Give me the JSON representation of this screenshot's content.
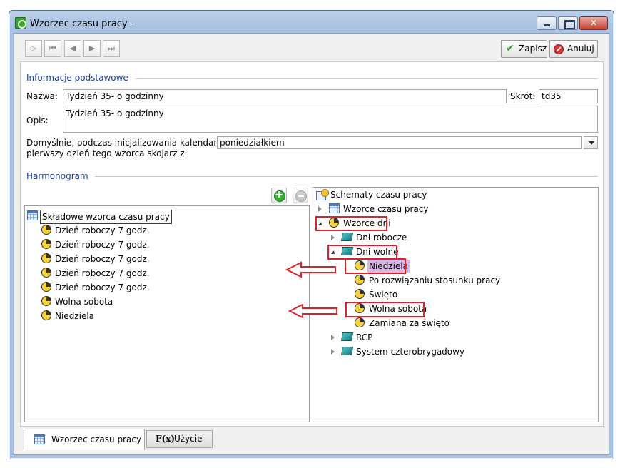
{
  "window": {
    "title": "Wzorzec czasu pracy -",
    "close_label": "✕"
  },
  "toolbar": {
    "nav_new": "▷",
    "nav_first": "⏮",
    "nav_prev": "◀",
    "nav_next": "▶",
    "nav_last": "⏭",
    "save_label": "Zapisz",
    "cancel_label": "Anuluj"
  },
  "basic_info": {
    "section_title": "Informacje podstawowe",
    "name_label": "Nazwa:",
    "name_value": "Tydzień 35- o godzinny",
    "short_label": "Skrót:",
    "short_value": "td35",
    "desc_label": "Opis:",
    "desc_value": "Tydzień 35- o godzinny",
    "default_label_line1": "Domyślnie, podczas inicjalizowania kalendarza,",
    "default_label_line2": "pierwszy dzień tego wzorca skojarz z:",
    "default_value": "poniedziałkiem"
  },
  "schedule": {
    "section_title": "Harmonogram"
  },
  "left_tree": {
    "root": "Składowe wzorca czasu pracy",
    "items": [
      "Dzień roboczy 7 godz.",
      "Dzień roboczy 7 godz.",
      "Dzień roboczy 7 godz.",
      "Dzień roboczy 7 godz.",
      "Dzień roboczy 7 godz.",
      "Wolna sobota",
      "Niedziela"
    ]
  },
  "right_tree": {
    "root": "Schematy czasu pracy",
    "templates": "Wzorce czasu pracy",
    "day_templates": "Wzorce dni",
    "work_days": "Dni robocze",
    "free_days": "Dni wolne",
    "free_items": [
      "Niedziela",
      "Po rozwiązaniu stosunku pracy",
      "Święto",
      "Wolna sobota",
      "Zamiana za święto"
    ],
    "rcp": "RCP",
    "four_brigade": "System czterobrygadowy"
  },
  "tabs": {
    "template": "Wzorzec czasu pracy",
    "usage": "Użycie",
    "fx_glyph": "F(x)"
  },
  "colors": {
    "highlight_red": "#e0202a",
    "selection": "#dcb6e6",
    "section_title": "#1b3f8f"
  }
}
